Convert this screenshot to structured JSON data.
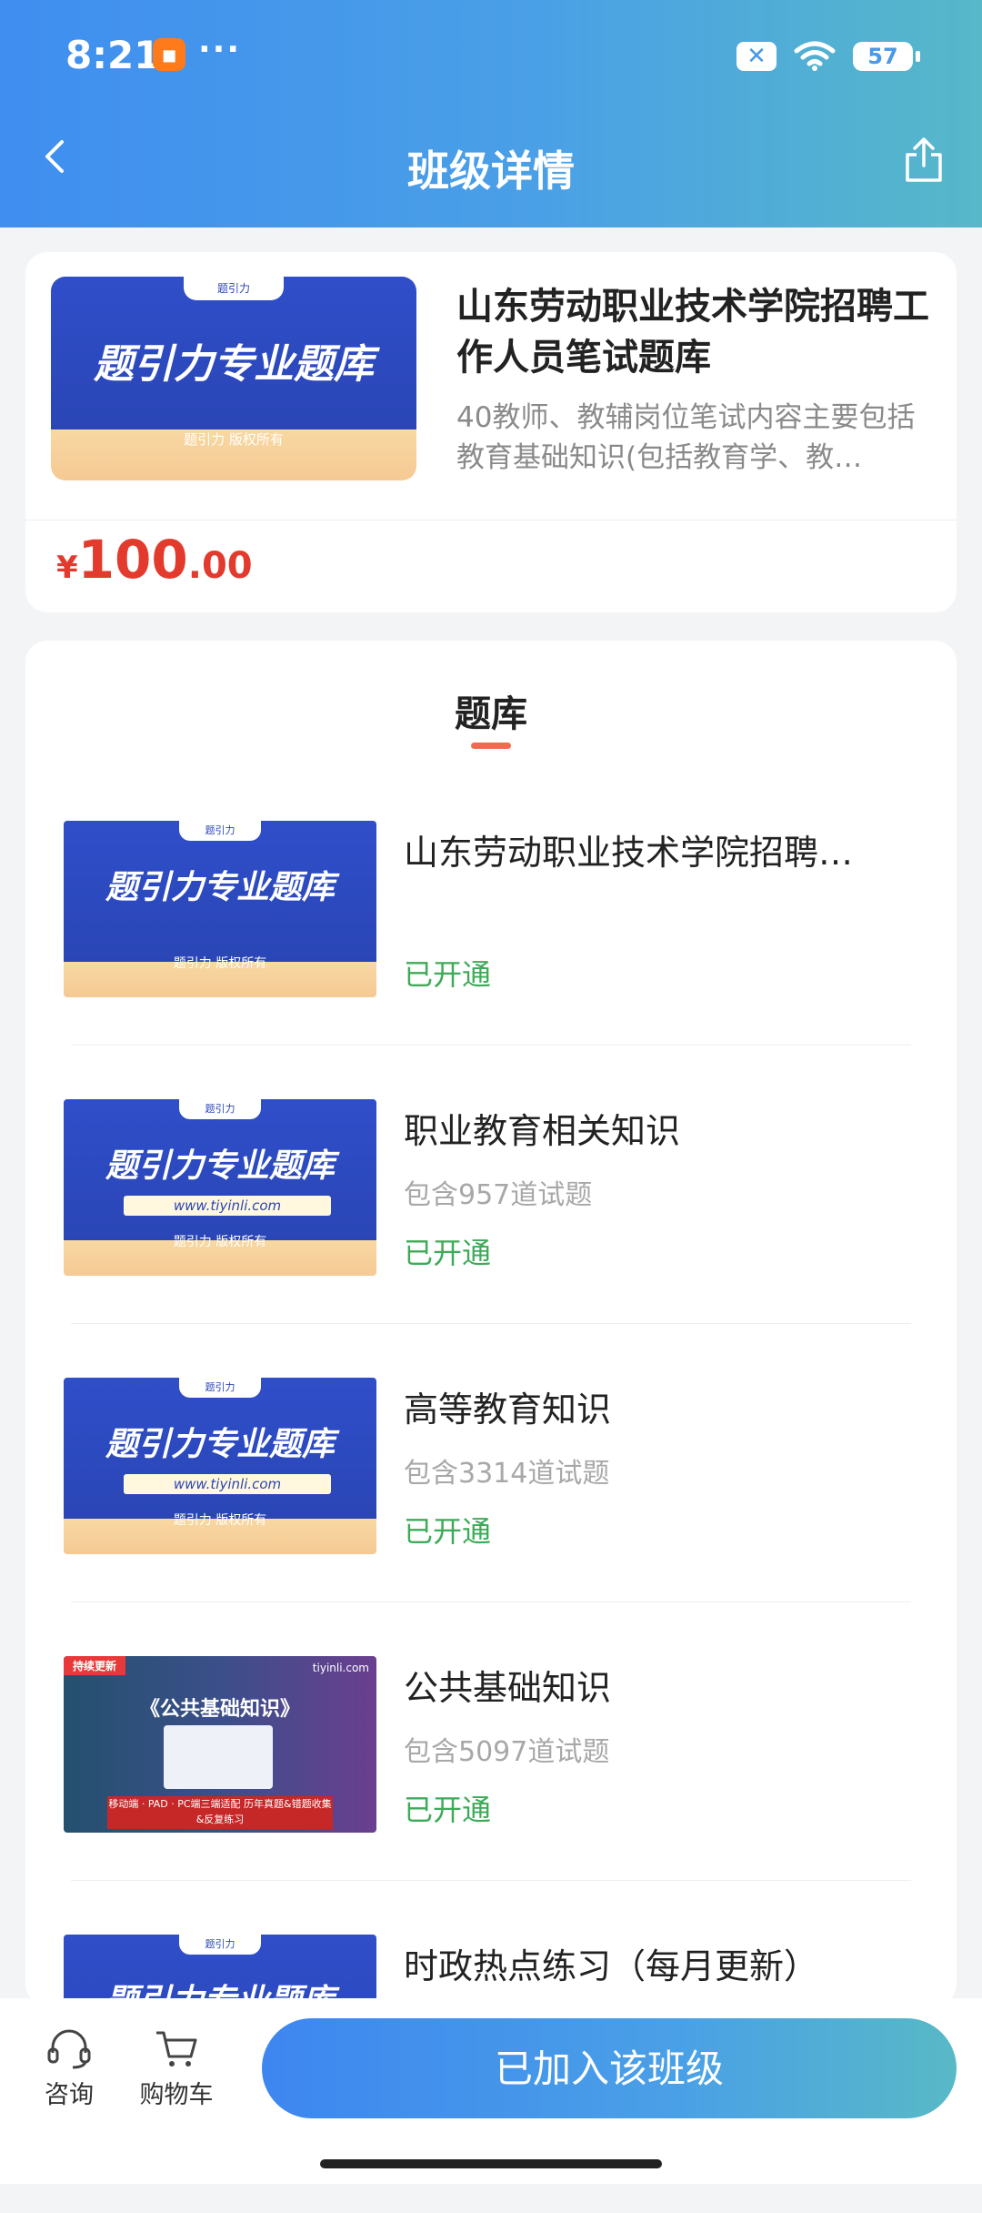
{
  "status_bar": {
    "time": "8:21",
    "dots": "···",
    "battery": "57"
  },
  "header": {
    "title": "班级详情"
  },
  "course": {
    "cover_brand": "题引力",
    "cover_title": "题引力专业题库",
    "cover_footer": "题引力 版权所有",
    "title": "山东劳动职业技术学院招聘工作人员笔试题库",
    "description": "40教师、教辅岗位笔试内容主要包括教育基础知识(包括教育学、教…",
    "price_symbol": "¥",
    "price_int": "100",
    "price_dec": ".00"
  },
  "bank": {
    "heading": "题库",
    "items": [
      {
        "title": "山东劳动职业技术学院招聘…",
        "count": "",
        "status": "已开通",
        "thumb_title": "题引力专业题库",
        "thumb_footer": "题引力 版权所有",
        "thumb_brand": "题引力"
      },
      {
        "title": "职业教育相关知识",
        "count": "包含957道试题",
        "status": "已开通",
        "thumb_title": "题引力专业题库",
        "thumb_url": "www.tiyinli.com",
        "thumb_footer": "题引力 版权所有",
        "thumb_brand": "题引力"
      },
      {
        "title": "高等教育知识",
        "count": "包含3314道试题",
        "status": "已开通",
        "thumb_title": "题引力专业题库",
        "thumb_url": "www.tiyinli.com",
        "thumb_footer": "题引力 版权所有",
        "thumb_brand": "题引力"
      },
      {
        "title": "公共基础知识",
        "count": "包含5097道试题",
        "status": "已开通",
        "thumb_badge": "持续更新",
        "thumb_title": "《公共基础知识》",
        "thumb_brand": "tiyinli.com",
        "thumb_bar": "移动端 · PAD · PC端三端适配 历年真题&错题收集&反复练习"
      },
      {
        "title": "时政热点练习（每月更新）",
        "count": "",
        "status": "",
        "thumb_title": "题引力专业题库",
        "thumb_brand": "题引力"
      }
    ]
  },
  "bottom_bar": {
    "consult": "咨询",
    "cart": "购物车",
    "join": "已加入该班级"
  }
}
